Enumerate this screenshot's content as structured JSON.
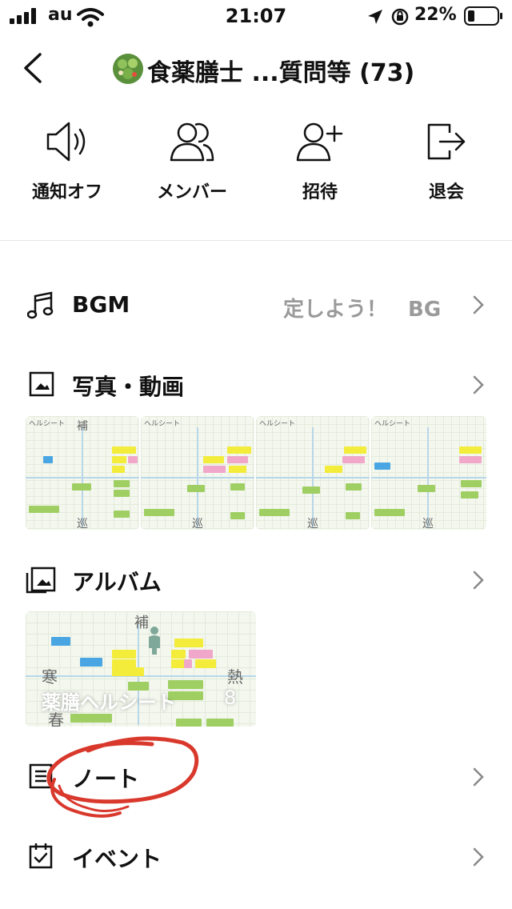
{
  "status_bar": {
    "carrier": "au",
    "time": "21:07",
    "battery_percent": "22%"
  },
  "header": {
    "title": "食薬膳士 ...質問等 (73)"
  },
  "actions": [
    {
      "label": "通知オフ",
      "icon": "speaker-icon"
    },
    {
      "label": "メンバー",
      "icon": "members-icon"
    },
    {
      "label": "招待",
      "icon": "add-user-icon"
    },
    {
      "label": "退会",
      "icon": "leave-icon"
    }
  ],
  "rows": {
    "bgm": {
      "label": "BGM",
      "value": "定しよう！　BG"
    },
    "photos": {
      "label": "写真・動画"
    },
    "album": {
      "label": "アルバム",
      "album_name": "薬膳ヘルシート",
      "album_count": "8"
    },
    "note": {
      "label": "ノート"
    },
    "event": {
      "label": "イベント"
    }
  },
  "thumbnail_text": {
    "title": "ヘルシート",
    "top": "補",
    "bottom": "巡",
    "left": "寒",
    "right": "熱",
    "left_bottom": "春"
  },
  "colors": {
    "annotation_circle": "#d9382c",
    "chevron": "#888888",
    "chip_yellow": "#f3ec3a",
    "chip_green": "#9fcf63",
    "chip_pink": "#f0a7c9",
    "chip_blue": "#4aa6e3"
  }
}
